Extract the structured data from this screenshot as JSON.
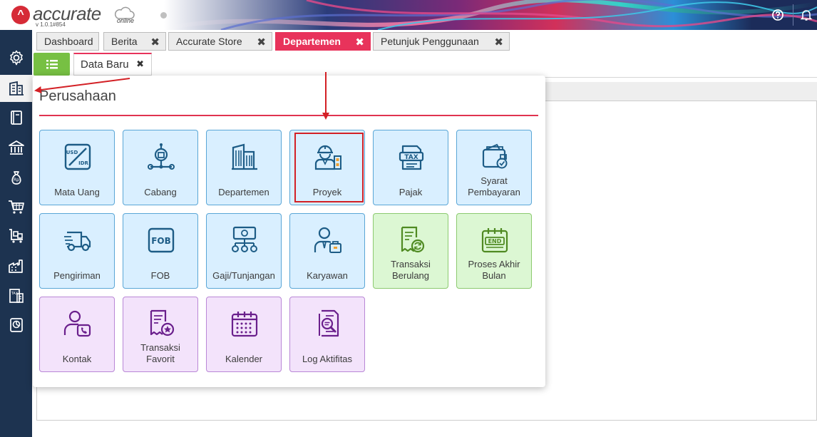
{
  "app": {
    "logo_text": "accurate",
    "version": "v 1.0.1#854",
    "logo_suffix": "online"
  },
  "tabs": [
    {
      "label": "Dashboard",
      "closable": false,
      "active": false
    },
    {
      "label": "Berita",
      "closable": true,
      "active": false
    },
    {
      "label": "Accurate Store",
      "closable": true,
      "active": false
    },
    {
      "label": "Departemen",
      "closable": true,
      "active": true
    },
    {
      "label": "Petunjuk Penggunaan",
      "closable": true,
      "active": false
    }
  ],
  "subtab": {
    "label": "Data Baru",
    "close": "✖"
  },
  "tab_close": "✖",
  "popup": {
    "title": "Perusahaan",
    "tiles": [
      {
        "label": "Mata Uang",
        "icon": "currency-exchange-icon",
        "color": "blue"
      },
      {
        "label": "Cabang",
        "icon": "branch-network-icon",
        "color": "blue"
      },
      {
        "label": "Departemen",
        "icon": "building-icon",
        "color": "blue"
      },
      {
        "label": "Proyek",
        "icon": "construction-worker-icon",
        "color": "blue"
      },
      {
        "label": "Pajak",
        "icon": "tax-document-icon",
        "color": "blue"
      },
      {
        "label": "Syarat\nPembayaran",
        "icon": "wallet-check-icon",
        "color": "blue"
      },
      {
        "label": "Pengiriman",
        "icon": "delivery-truck-icon",
        "color": "blue"
      },
      {
        "label": "FOB",
        "icon": "fob-icon",
        "color": "blue"
      },
      {
        "label": "Gaji/Tunjangan",
        "icon": "salary-tree-icon",
        "color": "blue"
      },
      {
        "label": "Karyawan",
        "icon": "employee-icon",
        "color": "blue"
      },
      {
        "label": "Transaksi\nBerulang",
        "icon": "recurring-transaction-icon",
        "color": "green"
      },
      {
        "label": "Proses Akhir\nBulan",
        "icon": "end-calendar-icon",
        "color": "green"
      },
      {
        "label": "Kontak",
        "icon": "contact-phone-icon",
        "color": "purple"
      },
      {
        "label": "Transaksi\nFavorit",
        "icon": "favorite-receipt-icon",
        "color": "purple"
      },
      {
        "label": "Kalender",
        "icon": "calendar-icon",
        "color": "purple"
      },
      {
        "label": "Log Aktifitas",
        "icon": "activity-log-icon",
        "color": "purple"
      }
    ]
  },
  "colors": {
    "accent": "#e8335b",
    "sidebar": "#1d3350",
    "menu_button": "#77c043",
    "tile_blue": "#d9efff",
    "tile_green": "#dcf7d3",
    "tile_purple": "#f3e3fb",
    "highlight": "#d32025"
  },
  "sidebar_icons": [
    "gear-icon",
    "company-building-icon",
    "book-icon",
    "bank-icon",
    "money-bag-icon",
    "shopping-cart-icon",
    "inventory-cart-icon",
    "factory-icon",
    "tax-report-icon",
    "dashboard-report-icon"
  ]
}
